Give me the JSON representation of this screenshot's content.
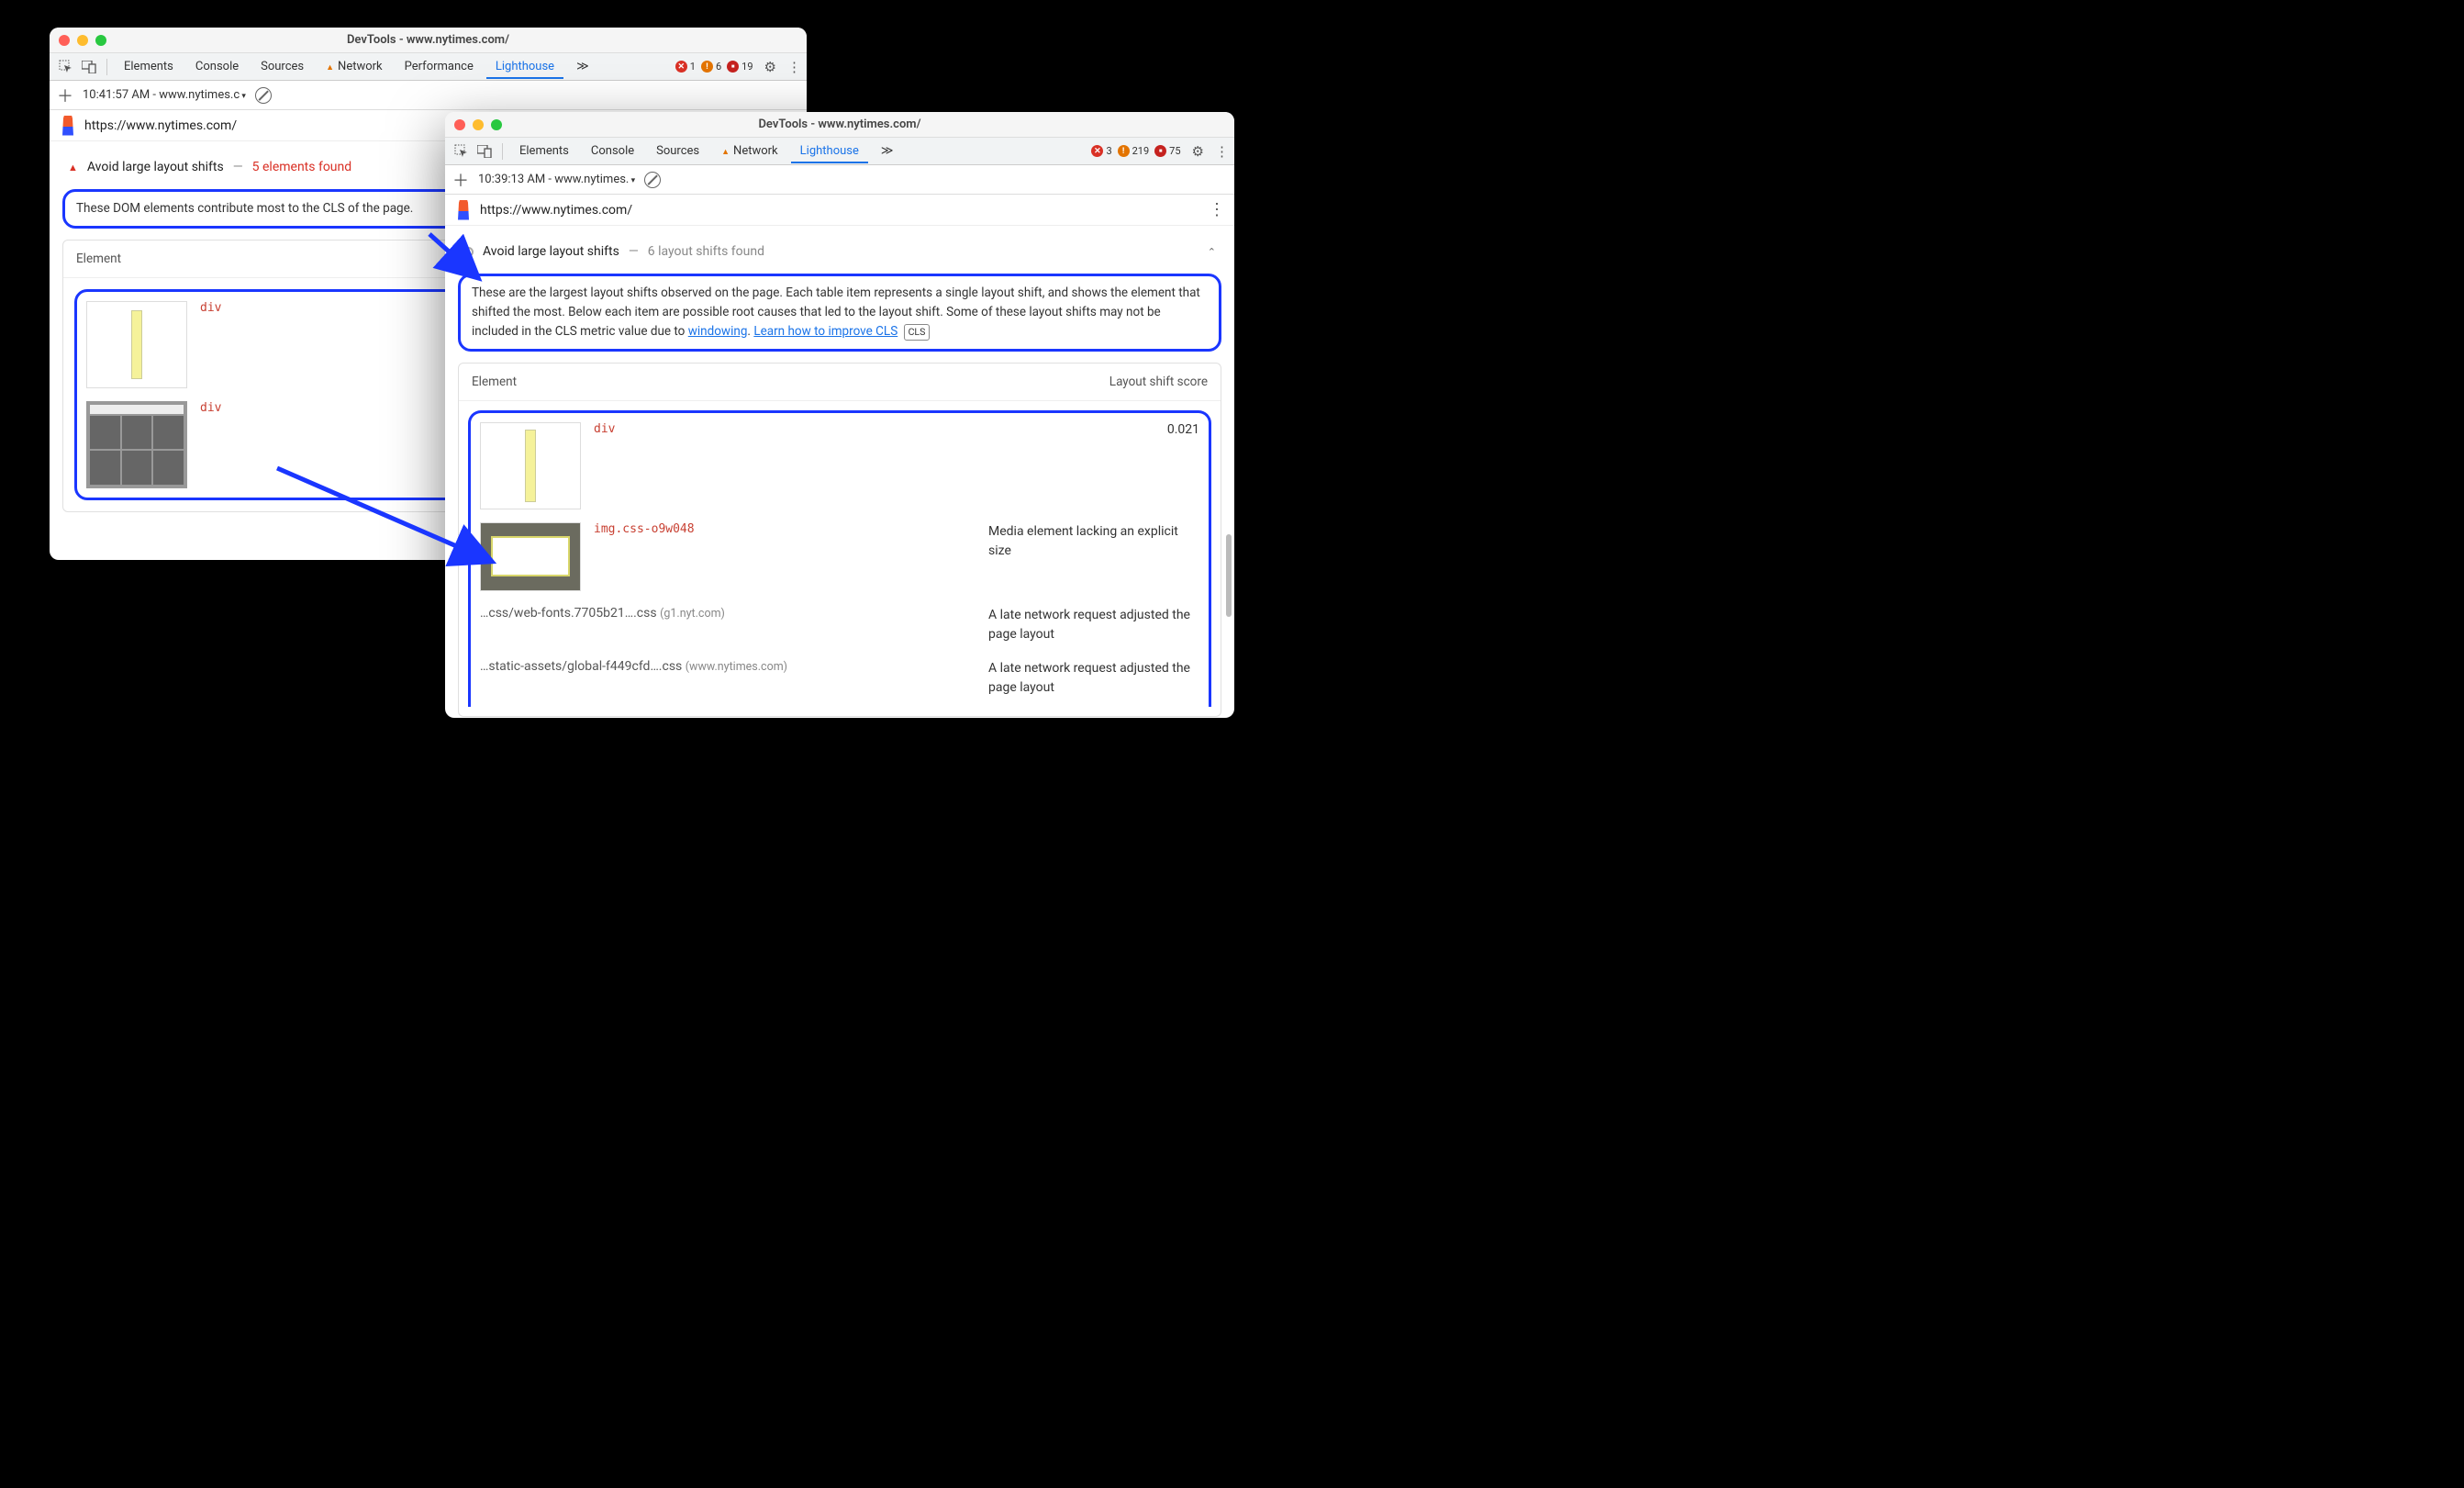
{
  "window_a": {
    "title": "DevTools - www.nytimes.com/",
    "tabs": [
      "Elements",
      "Console",
      "Sources",
      "Network",
      "Performance",
      "Lighthouse"
    ],
    "active_tab": "Lighthouse",
    "badges": {
      "errors": "1",
      "warnings": "6",
      "info": "19"
    },
    "run_label": "10:41:57 AM - www.nytimes.c",
    "url": "https://www.nytimes.com/",
    "audit": {
      "title": "Avoid large layout shifts",
      "found": "5 elements found",
      "desc": "These DOM elements contribute most to the CLS of the page.",
      "col_header": "Element",
      "rows": [
        {
          "selector": "div"
        },
        {
          "selector": "div"
        }
      ]
    }
  },
  "window_b": {
    "title": "DevTools - www.nytimes.com/",
    "tabs": [
      "Elements",
      "Console",
      "Sources",
      "Network",
      "Lighthouse"
    ],
    "active_tab": "Lighthouse",
    "badges": {
      "errors": "3",
      "warnings": "219",
      "info": "75"
    },
    "run_label": "10:39:13 AM - www.nytimes.",
    "url": "https://www.nytimes.com/",
    "audit": {
      "title": "Avoid large layout shifts",
      "found": "6 layout shifts found",
      "desc_pre": "These are the largest layout shifts observed on the page. Each table item represents a single layout shift, and shows the element that shifted the most. Below each item are possible root causes that led to the layout shift. Some of these layout shifts may not be included in the CLS metric value due to ",
      "link_windowing": "windowing",
      "link_learn": "Learn how to improve CLS",
      "cls_tag": "CLS",
      "col_element": "Element",
      "col_score": "Layout shift score",
      "row1": {
        "selector": "div",
        "score": "0.021"
      },
      "row2": {
        "selector": "img.css-o9w048",
        "reason": "Media element lacking an explicit size"
      },
      "cause1": {
        "src": "…css/web-fonts.7705b21….css",
        "dom": "(g1.nyt.com)",
        "reason": "A late network request adjusted the page layout"
      },
      "cause2": {
        "src": "…static-assets/global-f449cfd….css",
        "dom": "(www.nytimes.com)",
        "reason": "A late network request adjusted the page layout"
      }
    }
  }
}
